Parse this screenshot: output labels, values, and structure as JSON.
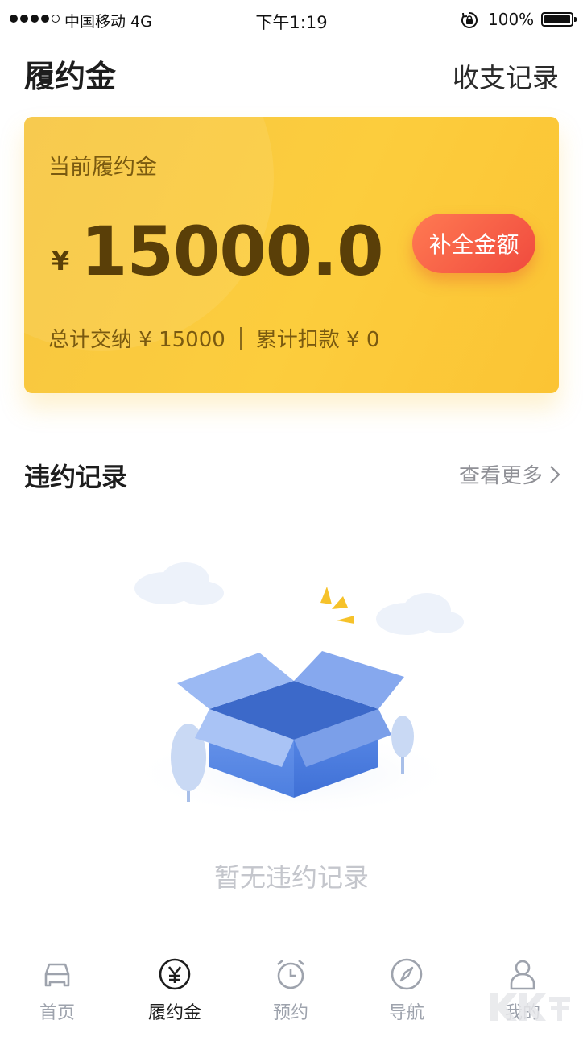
{
  "status_bar": {
    "carrier": "中国移动  4G",
    "time": "下午1:19",
    "battery": "100%"
  },
  "header": {
    "title": "履约金",
    "records_link": "收支记录"
  },
  "card": {
    "label": "当前履约金",
    "currency": "¥",
    "balance": "15000.0",
    "topup_label": "补全金额",
    "total_paid": "总计交纳 ¥ 15000",
    "total_deducted": "累计扣款 ¥ 0"
  },
  "violations": {
    "title": "违约记录",
    "see_more": "查看更多",
    "empty_text": "暂无违约记录"
  },
  "tabs": [
    {
      "label": "首页",
      "icon": "car-icon",
      "active": false
    },
    {
      "label": "履约金",
      "icon": "yen-icon",
      "active": true
    },
    {
      "label": "预约",
      "icon": "alarm-clock-icon",
      "active": false
    },
    {
      "label": "导航",
      "icon": "compass-icon",
      "active": false
    },
    {
      "label": "我的",
      "icon": "user-icon",
      "active": false
    }
  ],
  "colors": {
    "card": "#fcca3e",
    "button": "#f25a44",
    "accent_text": "#5a3f08"
  }
}
